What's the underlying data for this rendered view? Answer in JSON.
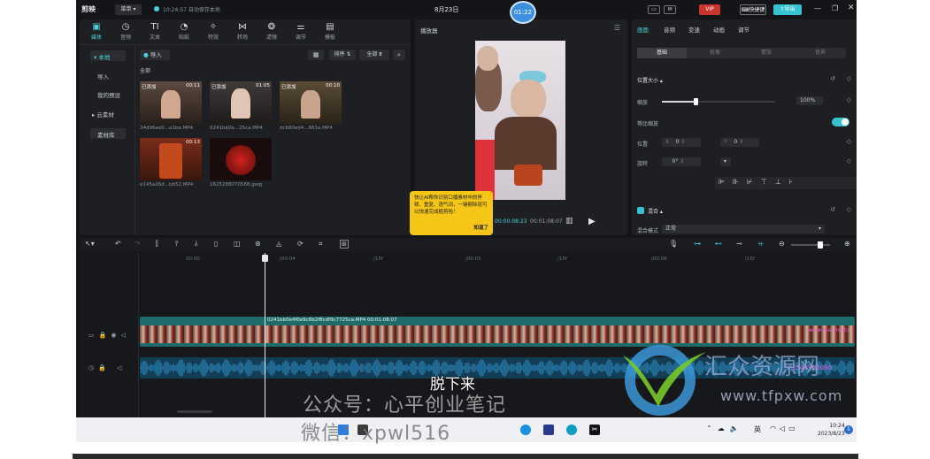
{
  "app": {
    "logo": "剪映",
    "menu": "菜单",
    "autosave": "10:24:57 自动保存本地",
    "project_title": "8月23日",
    "timer_badge": "01:22",
    "vip": "VIP",
    "shortcut": "快捷键",
    "export": "导出"
  },
  "media_tabs": [
    {
      "label": "媒体",
      "icon": "media-icon",
      "glyph": "▣"
    },
    {
      "label": "音频",
      "icon": "audio-icon",
      "glyph": "◷"
    },
    {
      "label": "文本",
      "icon": "text-icon",
      "glyph": "TI"
    },
    {
      "label": "贴纸",
      "icon": "sticker-icon",
      "glyph": "◔"
    },
    {
      "label": "特效",
      "icon": "effects-icon",
      "glyph": "✧"
    },
    {
      "label": "转场",
      "icon": "transition-icon",
      "glyph": "⋈"
    },
    {
      "label": "滤镜",
      "icon": "filter-icon",
      "glyph": "❂"
    },
    {
      "label": "调节",
      "icon": "adjust-icon",
      "glyph": "⚌"
    },
    {
      "label": "模板",
      "icon": "template-icon",
      "glyph": "▤"
    }
  ],
  "sidebar": {
    "local": "本地",
    "import": "导入",
    "presets": "我的预设",
    "cloud": "云素材",
    "library": "素材库"
  },
  "media": {
    "import_button": "导入",
    "sort": "排序",
    "filter_all": "全部",
    "section_all": "全部",
    "items": [
      {
        "added": "已添加",
        "duration": "00:11",
        "name": "34d96ee0...e1ba.MP4"
      },
      {
        "added": "已添加",
        "duration": "01:05",
        "name": "0241bb0e...25ca.MP4"
      },
      {
        "added": "已添加",
        "duration": "00:10",
        "name": "dcb80ed4...861e.MP4"
      },
      {
        "added": "",
        "duration": "00:13",
        "name": "e145a26d...bb52.MP4"
      },
      {
        "added": "",
        "duration": "",
        "name": "1625288070588.jpeg"
      }
    ]
  },
  "player": {
    "title": "播放器",
    "current_time": "00:00:08:23",
    "total_time": "00:01:08:07",
    "ratio": "比例",
    "tip_text": "快让AI帮你识别口播素材中的停顿、重复、语气词，一键剔除就可以快速完成粗剪啦！",
    "tip_button": "知道了"
  },
  "inspector": {
    "tabs": [
      "画面",
      "音频",
      "变速",
      "动画",
      "调节"
    ],
    "subtabs": [
      "基础",
      "抠像",
      "蒙版",
      "背景"
    ],
    "position_size": "位置大小",
    "scale_label": "缩放",
    "scale_value": "100%",
    "scale_fraction": 0.3,
    "uniform_scale": "等比缩放",
    "position_label": "位置",
    "x_label": "X",
    "x_value": "0",
    "y_label": "Y",
    "y_value": "0",
    "rotate_label": "旋转",
    "rotate_value": "0°",
    "blend": "混合",
    "blend_mode_label": "混合模式",
    "blend_mode_value": "正常"
  },
  "timeline": {
    "ruler": [
      "00:00",
      "|00:04",
      "|15f",
      "|00:05",
      "|15f",
      "|00:06",
      "|15f"
    ],
    "clip_label": "0241bb0e4f0e9c6b2f8cdf9c7725ca.MP4  00:01:08:07"
  },
  "overlays": {
    "subtitle": "脱下来",
    "watermark1": "公众号：心平创业笔记",
    "watermark2": "微信：xpwl516",
    "site_name": "汇众资源网",
    "site_url": "www.tfpxw.com",
    "clip_watermark_site": "www.macmp.tu",
    "clip_watermark_id": "V:1543952060"
  },
  "taskbar": {
    "ime": "英",
    "time": "10:24",
    "date": "2023/8/23",
    "notification_count": "1"
  }
}
